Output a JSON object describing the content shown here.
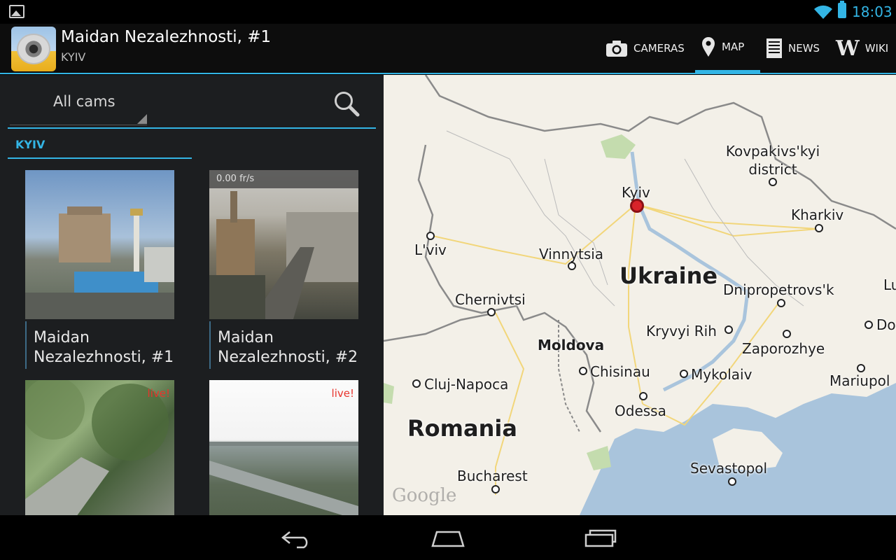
{
  "status_bar": {
    "clock": "18:03",
    "accent": "#33b5e5"
  },
  "action_bar": {
    "title": "Maidan Nezalezhnosti, #1",
    "subtitle": "KYIV",
    "tabs": [
      {
        "label": "CAMERAS",
        "icon": "camera-icon",
        "active": false
      },
      {
        "label": "MAP",
        "icon": "map-pin-icon",
        "active": true
      },
      {
        "label": "NEWS",
        "icon": "news-icon",
        "active": false
      },
      {
        "label": "WIKI",
        "icon": "wiki-icon",
        "active": false
      }
    ]
  },
  "left_panel": {
    "filter": {
      "selected": "All cams"
    },
    "section_header": "KYIV",
    "cameras": [
      {
        "name": "Maidan Nezalezhnosti, #1",
        "overlay": ""
      },
      {
        "name": "Maidan Nezalezhnosti, #2",
        "overlay": "0.00 fr/s"
      },
      {
        "name": "",
        "overlay": "live!"
      },
      {
        "name": "",
        "overlay": "live!"
      }
    ]
  },
  "map": {
    "countries": [
      "Ukraine",
      "Moldova",
      "Romania"
    ],
    "cities": [
      "Kyiv",
      "Kovpakivs'kyi district",
      "Kharkiv",
      "L'viv",
      "Vinnytsia",
      "Chernivtsi",
      "Dnipropetrovs'k",
      "Kryvyi Rih",
      "Zaporozhye",
      "Chisinau",
      "Mykolaiv",
      "Odessa",
      "Cluj-Napoca",
      "Mariupol",
      "Sevastopol",
      "Bucharest",
      "Do",
      "Lu"
    ],
    "attribution": "Google"
  }
}
